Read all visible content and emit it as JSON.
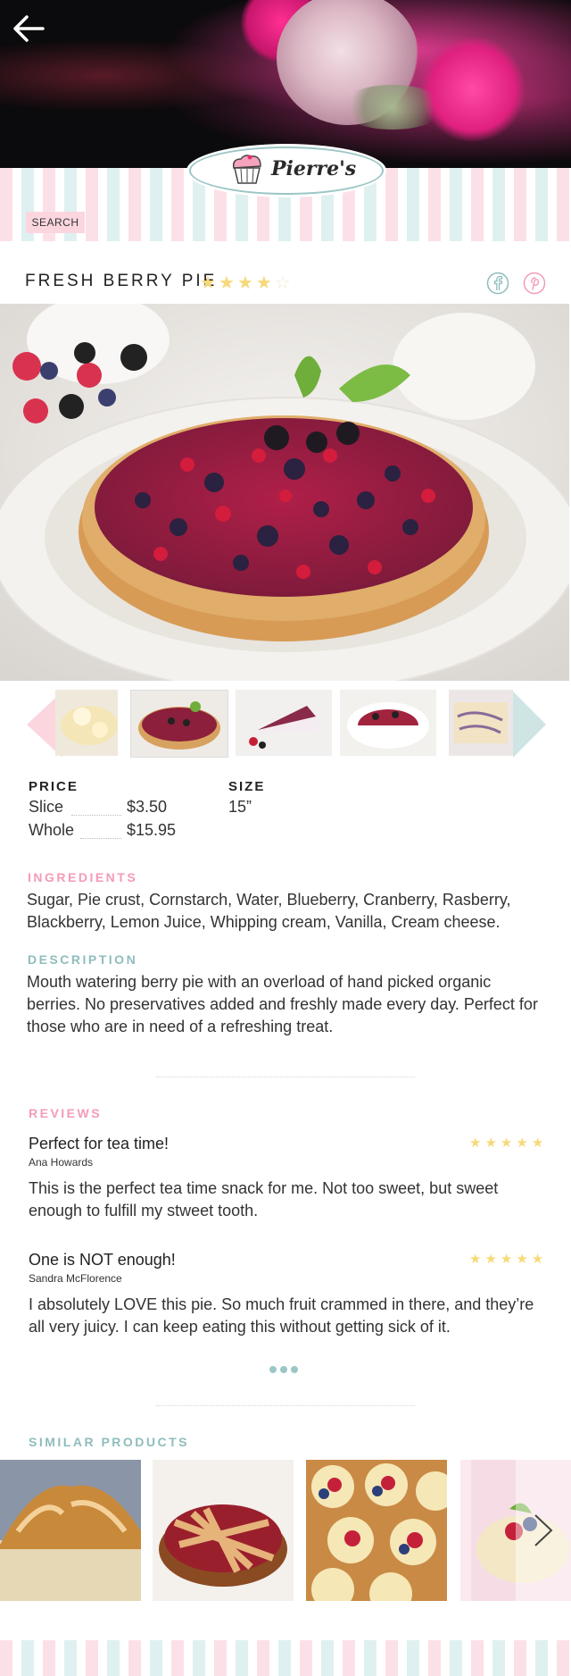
{
  "header": {
    "back_icon": "arrow-left-icon",
    "logo_text": "Pierre's",
    "search_label": "SEARCH"
  },
  "product": {
    "title": "FRESH BERRY PIE",
    "rating": 4,
    "rating_max": 5,
    "social_icons": [
      "facebook-icon",
      "pinterest-icon"
    ],
    "price_label": "PRICE",
    "prices": [
      {
        "name": "Slice",
        "value": "$3.50"
      },
      {
        "name": "Whole",
        "value": "$15.95"
      }
    ],
    "size_label": "SIZE",
    "size_value": "15”",
    "ingredients_label": "INGREDIENTS",
    "ingredients": "Sugar, Pie crust, Cornstarch, Water, Blueberry, Cranberry, Rasberry, Blackberry, Lemon Juice, Whipping cream, Vanilla, Cream cheese.",
    "description_label": "DESCRIPTION",
    "description": "Mouth watering berry pie with an overload of hand picked organic berries. No preservatives added and freshly made every day. Perfect for those who are in need of a refreshing treat."
  },
  "reviews": {
    "label": "REVIEWS",
    "items": [
      {
        "title": "Perfect for tea time!",
        "author": "Ana Howards",
        "rating": 5,
        "text": "This is the perfect tea time snack for me. Not too sweet, but sweet enough to fulfill my stweet tooth."
      },
      {
        "title": "One is NOT enough!",
        "author": "Sandra McFlorence",
        "rating": 5,
        "text": "I absolutely LOVE this pie. So much fruit crammed in there, and they’re all very juicy. I can keep eating this without getting sick of it."
      }
    ]
  },
  "similar": {
    "label": "SIMILAR PRODUCTS",
    "next_icon": "chevron-right-icon"
  },
  "colors": {
    "pink": "#f49bb6",
    "teal": "#8fbcbc",
    "star": "#f7d979",
    "stripe_pink": "#fce0e8",
    "stripe_teal": "#dff0f0"
  }
}
